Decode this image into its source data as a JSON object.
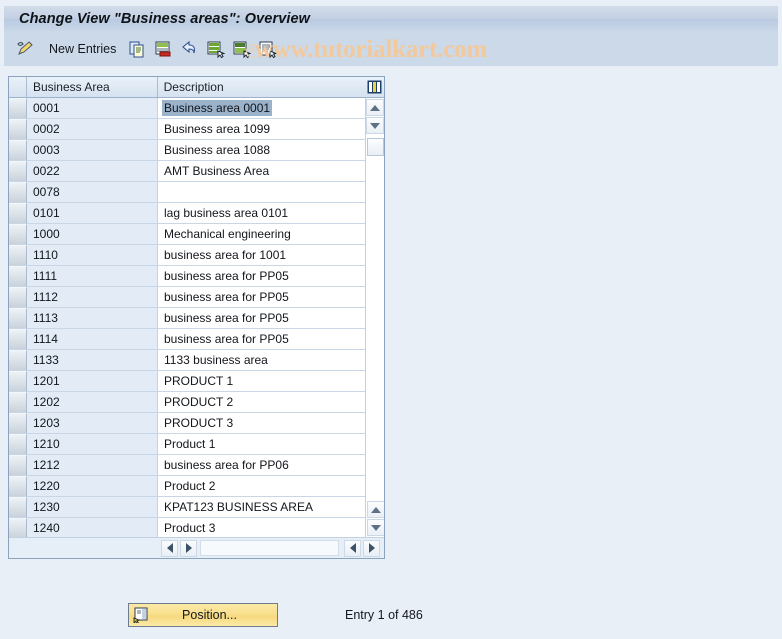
{
  "window": {
    "title": "Change View \"Business areas\": Overview"
  },
  "toolbar": {
    "edit_icon": "pencil-icon",
    "new_entries_label": "New Entries",
    "buttons": [
      {
        "name": "copy-icon",
        "label": "Copy"
      },
      {
        "name": "delete-icon",
        "label": "Delete"
      },
      {
        "name": "undo-icon",
        "label": "Undo"
      },
      {
        "name": "select-all-icon",
        "label": "Select All"
      },
      {
        "name": "deselect-all-icon",
        "label": "Deselect All"
      },
      {
        "name": "details-icon",
        "label": "Details"
      }
    ]
  },
  "watermark": {
    "registered": "®",
    "text": "www.tutorialkart.com"
  },
  "table": {
    "columns": [
      "Business Area",
      "Description"
    ],
    "config_icon": "column-settings-icon",
    "selected_row_index": 0,
    "rows": [
      {
        "code": "0001",
        "description": "Business area 0001"
      },
      {
        "code": "0002",
        "description": "Business area 1099"
      },
      {
        "code": "0003",
        "description": "Business area 1088"
      },
      {
        "code": "0022",
        "description": "AMT Business Area"
      },
      {
        "code": "0078",
        "description": ""
      },
      {
        "code": "0101",
        "description": "lag business area 0101"
      },
      {
        "code": "1000",
        "description": "Mechanical engineering"
      },
      {
        "code": "1110",
        "description": "business area for 1001"
      },
      {
        "code": "1111",
        "description": "business area for PP05"
      },
      {
        "code": "1112",
        "description": "business area for PP05"
      },
      {
        "code": "1113",
        "description": "business area for PP05"
      },
      {
        "code": "1114",
        "description": "business area for PP05"
      },
      {
        "code": "1133",
        "description": "1133 business area"
      },
      {
        "code": "1201",
        "description": "PRODUCT 1"
      },
      {
        "code": "1202",
        "description": "PRODUCT 2"
      },
      {
        "code": "1203",
        "description": "PRODUCT 3"
      },
      {
        "code": "1210",
        "description": "Product 1"
      },
      {
        "code": "1212",
        "description": "business area for PP06"
      },
      {
        "code": "1220",
        "description": "Product 2"
      },
      {
        "code": "1230",
        "description": "KPAT123 BUSINESS AREA"
      },
      {
        "code": "1240",
        "description": "Product 3"
      }
    ]
  },
  "footer": {
    "position_button_label": "Position...",
    "position_button_icon": "position-icon",
    "entry_status": "Entry 1 of 486"
  },
  "colors": {
    "window_bg": "#e9eff7",
    "toolbar_bg": "#ccd9e8",
    "title_bg": "#c3d1e4",
    "row_code_bg": "#e3ecf6",
    "selection_highlight": "#9bb2cb",
    "button_yellow": "#f8e08e",
    "watermark": "#f3c89a"
  }
}
